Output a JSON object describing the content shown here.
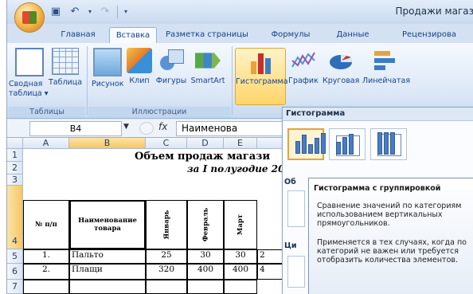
{
  "window": {
    "title": "Продажи магаз"
  },
  "quick_access": {
    "save": "save-icon",
    "undo": "undo-icon",
    "redo": "redo-icon"
  },
  "tabs": [
    {
      "label": "Главная"
    },
    {
      "label": "Вставка",
      "active": true
    },
    {
      "label": "Разметка страницы"
    },
    {
      "label": "Формулы"
    },
    {
      "label": "Данные"
    },
    {
      "label": "Рецензирова"
    }
  ],
  "ribbon": {
    "groups": [
      {
        "label": "Таблицы",
        "buttons": [
          {
            "label": "Сводная\nтаблица ▾",
            "icon": "pivot-table-icon"
          },
          {
            "label": "Таблица",
            "icon": "table-icon"
          }
        ]
      },
      {
        "label": "Иллюстрации",
        "buttons": [
          {
            "label": "Рисунок",
            "icon": "picture-icon"
          },
          {
            "label": "Клип",
            "icon": "clip-icon"
          },
          {
            "label": "Фигуры",
            "icon": "shapes-icon"
          },
          {
            "label": "SmartArt",
            "icon": "smartart-icon"
          }
        ]
      },
      {
        "label": "",
        "buttons": [
          {
            "label": "Гистограмма",
            "icon": "column-chart-icon",
            "selected": true
          },
          {
            "label": "График",
            "icon": "line-chart-icon"
          },
          {
            "label": "Круговая",
            "icon": "pie-chart-icon"
          },
          {
            "label": "Линейчатая",
            "icon": "bar-chart-icon"
          }
        ]
      }
    ]
  },
  "formula_bar": {
    "name_box": "B4",
    "fx": "fx",
    "value": "Наименова"
  },
  "sheet": {
    "columns": [
      "A",
      "B",
      "C",
      "D",
      "E"
    ],
    "rows": [
      "1",
      "2",
      "3",
      "4",
      "5",
      "6"
    ],
    "title": "Объем продаж магази",
    "subtitle": "за I полугодие 20",
    "headers": {
      "num": "№ п/п",
      "name": "Наименование товара",
      "m1": "Январь",
      "m2": "Февраль",
      "m3": "Март"
    },
    "data": [
      {
        "num": "1.",
        "name": "Пальто",
        "v1": "25",
        "v2": "30",
        "v3": "30",
        "extra": "2"
      },
      {
        "num": "2.",
        "name": "Плащи",
        "v1": "320",
        "v2": "400",
        "v3": "400",
        "extra": "4"
      }
    ]
  },
  "gallery": {
    "header": "Гистограмма",
    "section2_label": "Об",
    "section3_label": "Ци"
  },
  "tooltip": {
    "title": "Гистограмма с группировкой",
    "line1": "Сравнение значений по категориям",
    "line2": "использованием вертикальных",
    "line3": "прямоугольников.",
    "line4": "Применяется в тех случаях, когда по",
    "line5": "категорий не важен или требуется",
    "line6": "отобразить количества элементов."
  },
  "colors": {
    "accent": "#15428b",
    "selected_tab": "#f7fbff",
    "highlight": "#ffd56a"
  }
}
